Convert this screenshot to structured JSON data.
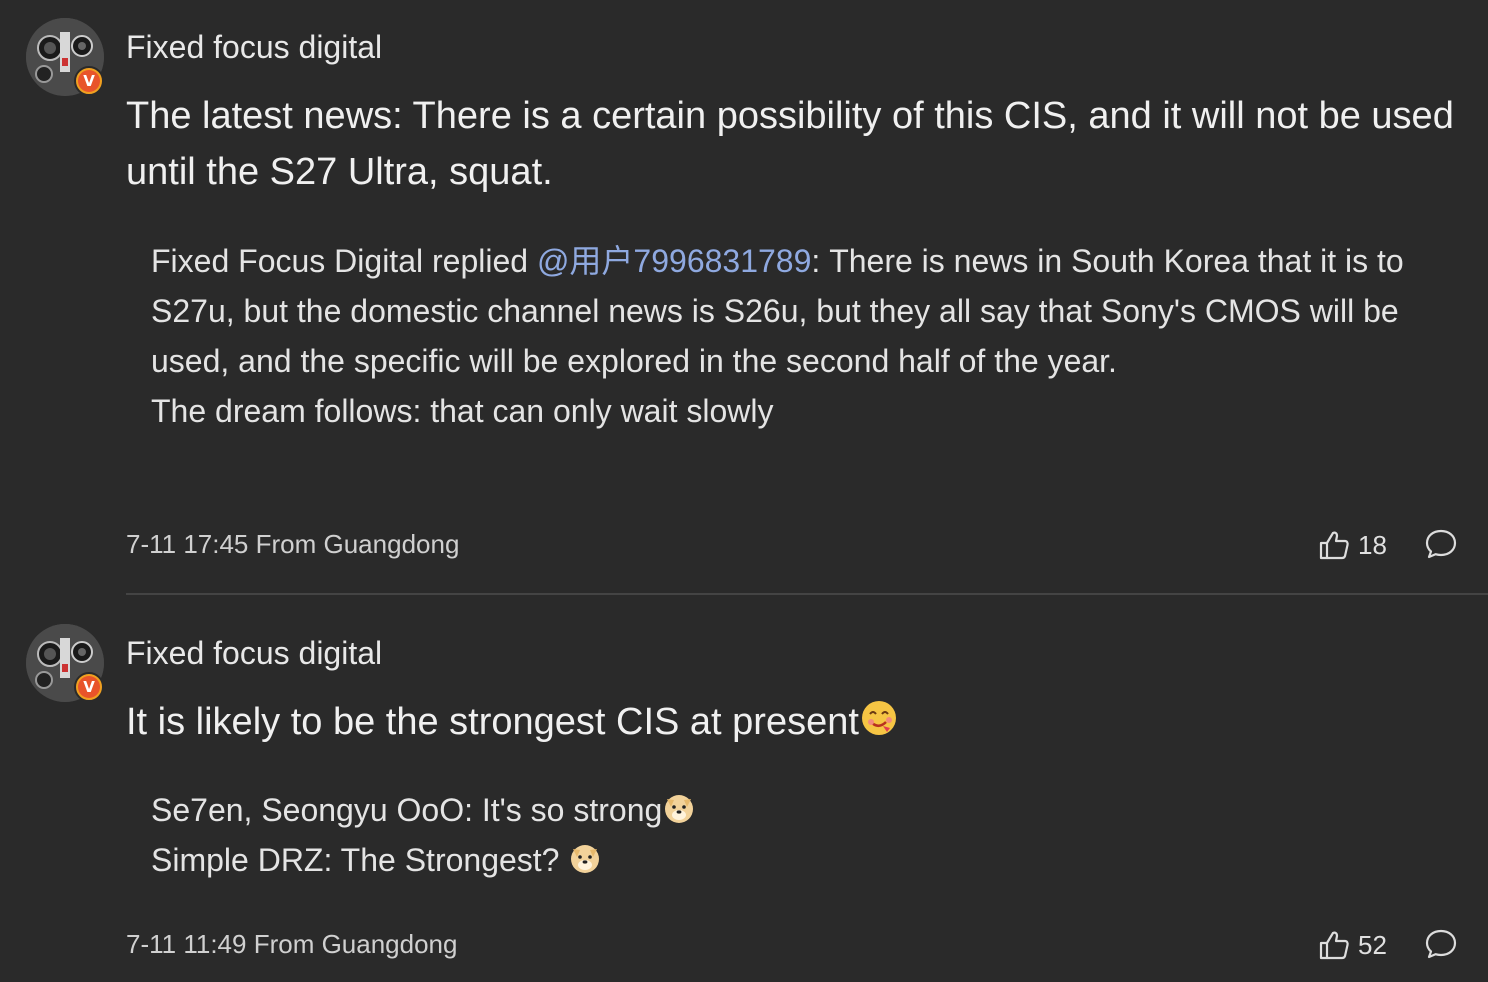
{
  "comments": [
    {
      "author": "Fixed focus digital",
      "text": "The latest news: There is a certain possibility of this CIS, and it will not be used until the S27 Ultra, squat.",
      "replies": {
        "r1_prefix": "Fixed Focus Digital replied ",
        "r1_mention": "@用户7996831789",
        "r1_text": ": There is news in South Korea that it is to S27u, but the domestic channel news is S26u, but they all say that Sony's CMOS will be used, and the specific will be explored in the second half of the year.",
        "r2": "The dream follows: that can only wait slowly"
      },
      "timestamp": "7-11 17:45 From Guangdong",
      "likes": "18"
    },
    {
      "author": "Fixed focus digital",
      "text": "It is likely to be the strongest CIS at present",
      "replies": {
        "r1": "Se7en, Seongyu OoO: It's so strong",
        "r2": "Simple DRZ: The Strongest? "
      },
      "timestamp": "7-11 11:49 From Guangdong",
      "likes": "52"
    }
  ],
  "badge_label": "V",
  "colors": {
    "background": "#2a2a2a",
    "mention": "#8fa9e0",
    "badge_outer": "#f0a020",
    "badge_inner": "#e8542a"
  },
  "icons": [
    "avatar-camera",
    "verified-badge-icon",
    "thumbs-up-icon",
    "reply-bubble-icon",
    "drooling-face-emoji",
    "doge-emoji"
  ]
}
